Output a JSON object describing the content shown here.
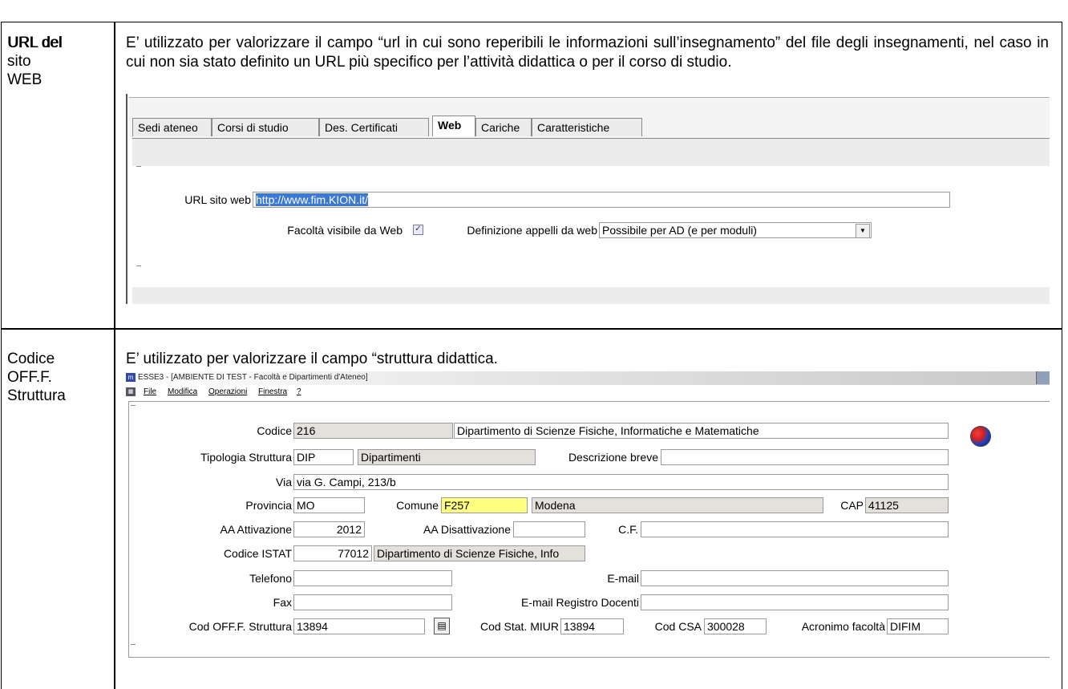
{
  "row1": {
    "label_lines": [
      "URL del",
      "sito",
      "WEB"
    ],
    "description": "E’ utilizzato per valorizzare il campo “url in cui sono reperibili le informazioni sull’insegnamento” del file degli insegnamenti, nel caso in cui non sia stato definito un URL più specifico per l’attività didattica o per il corso di studio.",
    "tabs": [
      "Sedi ateneo",
      "Corsi di studio",
      "Des. Certificati",
      "Web",
      "Cariche",
      "Caratteristiche"
    ],
    "active_tab": "Web",
    "url_label": "URL sito web",
    "url_value": "http://www.fim.KION.it/",
    "visible_label": "Facoltà visibile da Web",
    "visible_checked": true,
    "appelli_label": "Definizione appelli da web",
    "appelli_value": "Possibile per AD (e per moduli)"
  },
  "row2": {
    "label_lines": [
      "Codice",
      "OFF.F.",
      "Struttura"
    ],
    "description": "E’ utilizzato per valorizzare il campo “struttura didattica.",
    "window_title": "ESSE3 - [AMBIENTE DI TEST - Facoltà e Dipartimenti d'Ateneo]",
    "menu": [
      "File",
      "Modifica",
      "Operazioni",
      "Finestra",
      "?"
    ],
    "form": {
      "codice_label": "Codice",
      "codice": "216",
      "nome": "Dipartimento di Scienze Fisiche, Informatiche e Matematiche",
      "tipologia_label": "Tipologia Struttura",
      "tipologia_code": "DIP",
      "tipologia_desc": "Dipartimenti",
      "descr_breve_label": "Descrizione breve",
      "descr_breve": "",
      "via_label": "Via",
      "via": "via G. Campi, 213/b",
      "provincia_label": "Provincia",
      "provincia": "MO",
      "comune_label": "Comune",
      "comune_code": "F257",
      "comune_name": "Modena",
      "cap_label": "CAP",
      "cap": "41125",
      "aa_att_label": "AA Attivazione",
      "aa_att": "2012",
      "aa_disatt_label": "AA Disattivazione",
      "aa_disatt": "",
      "cf_label": "C.F.",
      "cf": "",
      "istat_label": "Codice ISTAT",
      "istat": "77012",
      "istat_desc": "Dipartimento di Scienze Fisiche, Info",
      "telefono_label": "Telefono",
      "telefono": "",
      "email_label": "E-mail",
      "email": "",
      "fax_label": "Fax",
      "fax": "",
      "email_doc_label": "E-mail Registro Docenti",
      "email_doc": "",
      "off_label": "Cod OFF.F. Struttura",
      "off": "13894",
      "miur_label": "Cod Stat. MIUR",
      "miur": "13894",
      "csa_label": "Cod CSA",
      "csa": "300028",
      "acr_label": "Acronimo facoltà",
      "acr": "DIFIM"
    }
  }
}
